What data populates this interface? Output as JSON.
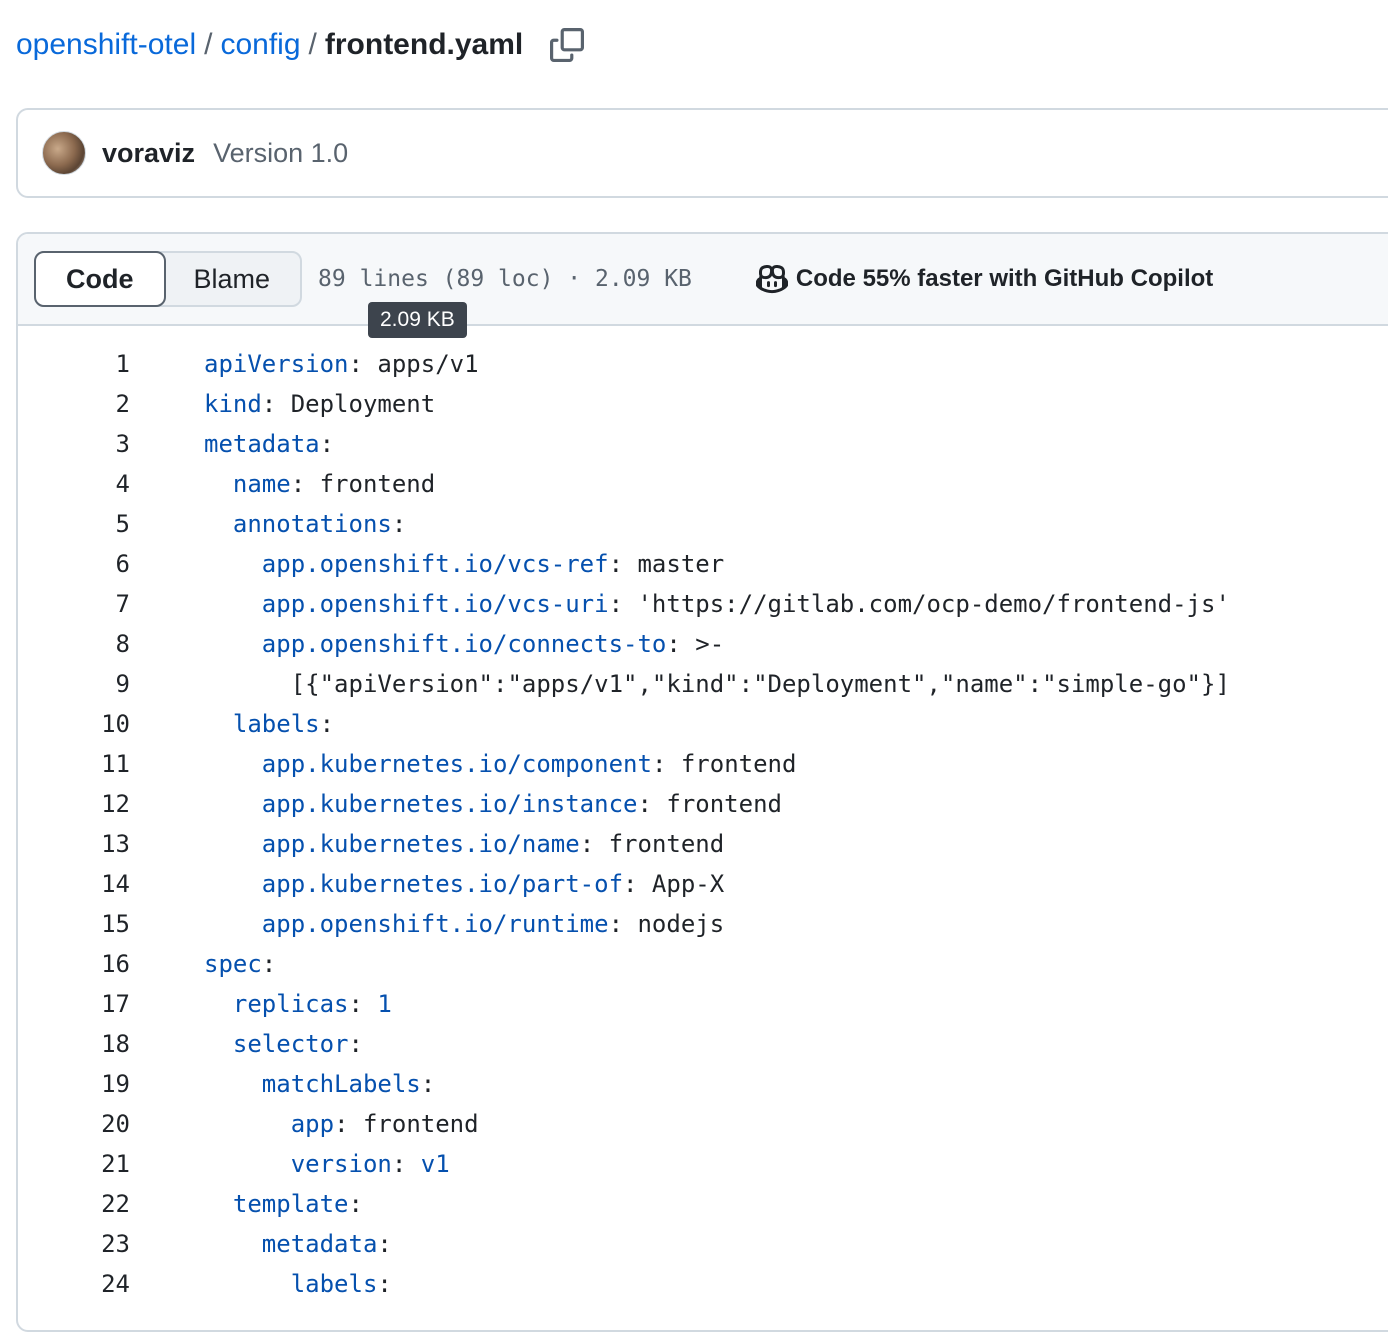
{
  "breadcrumb": {
    "repo": "openshift-otel",
    "folder": "config",
    "file": "frontend.yaml",
    "separator": "/"
  },
  "commit": {
    "author": "voraviz",
    "message": "Version 1.0"
  },
  "file_header": {
    "tabs": [
      "Code",
      "Blame"
    ],
    "active_tab": "Code",
    "info": "89 lines (89 loc) · 2.09 KB",
    "tooltip": "2.09 KB",
    "copilot": "Code 55% faster with GitHub Copilot"
  },
  "code_lines": [
    {
      "n": "1",
      "indent": "",
      "key": "apiVersion",
      "val": " apps/v1"
    },
    {
      "n": "2",
      "indent": "",
      "key": "kind",
      "val": " Deployment"
    },
    {
      "n": "3",
      "indent": "",
      "key": "metadata",
      "val": ""
    },
    {
      "n": "4",
      "indent": "  ",
      "key": "name",
      "val": " frontend"
    },
    {
      "n": "5",
      "indent": "  ",
      "key": "annotations",
      "val": ""
    },
    {
      "n": "6",
      "indent": "    ",
      "key": "app.openshift.io/vcs-ref",
      "val": " master"
    },
    {
      "n": "7",
      "indent": "    ",
      "key": "app.openshift.io/vcs-uri",
      "val": " 'https://gitlab.com/ocp-demo/frontend-js'"
    },
    {
      "n": "8",
      "indent": "    ",
      "key": "app.openshift.io/connects-to",
      "val": " >-"
    },
    {
      "n": "9",
      "indent": "      ",
      "text": "[{\"apiVersion\":\"apps/v1\",\"kind\":\"Deployment\",\"name\":\"simple-go\"}]"
    },
    {
      "n": "10",
      "indent": "  ",
      "key": "labels",
      "val": ""
    },
    {
      "n": "11",
      "indent": "    ",
      "key": "app.kubernetes.io/component",
      "val": " frontend"
    },
    {
      "n": "12",
      "indent": "    ",
      "key": "app.kubernetes.io/instance",
      "val": " frontend"
    },
    {
      "n": "13",
      "indent": "    ",
      "key": "app.kubernetes.io/name",
      "val": " frontend"
    },
    {
      "n": "14",
      "indent": "    ",
      "key": "app.kubernetes.io/part-of",
      "val": " App-X"
    },
    {
      "n": "15",
      "indent": "    ",
      "key": "app.openshift.io/runtime",
      "val": " nodejs"
    },
    {
      "n": "16",
      "indent": "",
      "key": "spec",
      "val": ""
    },
    {
      "n": "17",
      "indent": "  ",
      "key": "replicas",
      "val": " 1",
      "num": true
    },
    {
      "n": "18",
      "indent": "  ",
      "key": "selector",
      "val": ""
    },
    {
      "n": "19",
      "indent": "    ",
      "key": "matchLabels",
      "val": ""
    },
    {
      "n": "20",
      "indent": "      ",
      "key": "app",
      "val": " frontend"
    },
    {
      "n": "21",
      "indent": "      ",
      "key": "version",
      "val": " v1",
      "num": true
    },
    {
      "n": "22",
      "indent": "  ",
      "key": "template",
      "val": ""
    },
    {
      "n": "23",
      "indent": "    ",
      "key": "metadata",
      "val": ""
    },
    {
      "n": "24",
      "indent": "      ",
      "key": "labels",
      "val": ""
    }
  ]
}
